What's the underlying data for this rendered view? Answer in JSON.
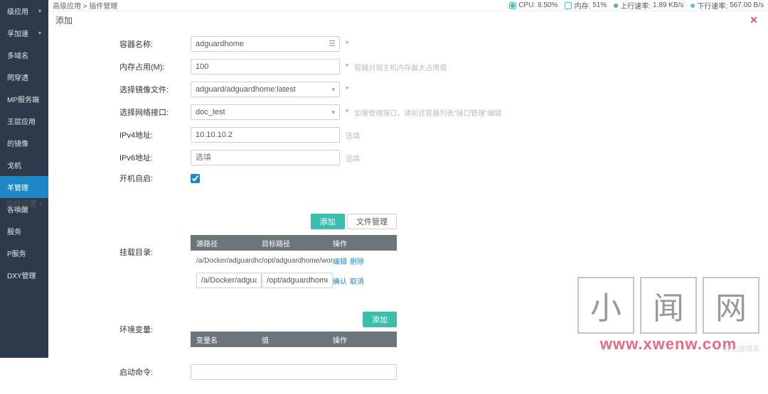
{
  "breadcrumb": {
    "a": "高级应用",
    "sep": ">",
    "b": "插件管理"
  },
  "status": {
    "cpu_label": "CPU:",
    "cpu_val": "8.50%",
    "mem_label": "内存:",
    "mem_val": "51%",
    "up_label": "上行速率:",
    "up_val": "1.89 KB/s",
    "dn_label": "下行速率:",
    "dn_val": "567.00 B/s"
  },
  "panel": {
    "title": "添加",
    "close": "✕"
  },
  "sidebar": {
    "items": [
      {
        "label": "级应用",
        "expand": true
      },
      {
        "label": "孚加速",
        "expand": true
      },
      {
        "label": "多域名"
      },
      {
        "label": "罔穿透"
      },
      {
        "label": "MP服务端"
      },
      {
        "label": "王层应用"
      },
      {
        "label": "的镜像"
      },
      {
        "label": "戈机"
      },
      {
        "label": "羊管理",
        "active": true
      },
      {
        "label": "各唤醒"
      },
      {
        "label": "服务"
      },
      {
        "label": "P服务"
      },
      {
        "label": "DXY管理"
      }
    ]
  },
  "form": {
    "container_name": {
      "label": "容器名称:",
      "value": "adguardhome"
    },
    "mem": {
      "label": "内存占用(M):",
      "value": "100",
      "hint": "容器对宿主机内存最大占用值"
    },
    "image": {
      "label": "选择镜像文件:",
      "value": "adguard/adguardhome:latest"
    },
    "net": {
      "label": "选择网络接口:",
      "value": "doc_test",
      "hint": "如需管理接口，请前往容器列表\"接口管理\"编辑"
    },
    "ipv4": {
      "label": "IPv4地址:",
      "value": "10.10.10.2",
      "ph": "选填"
    },
    "ipv6": {
      "label": "IPv6地址:",
      "value": "",
      "ph": "选填"
    },
    "autostart": {
      "label": "开机自启:"
    },
    "req": "*"
  },
  "advanced_label": "高级设置",
  "mount": {
    "label": "挂载目录:",
    "add_btn": "添加",
    "fm_btn": "文件管理",
    "head": {
      "c1": "源路径",
      "c2": "目标路径",
      "c3": "操作"
    },
    "rows": [
      {
        "src": "/a/Docker/adguardhome",
        "dst": "/opt/adguardhome/worl",
        "edit": "编辑",
        "del": "删除"
      }
    ],
    "edit_row": {
      "src": "/a/Docker/adguardhome",
      "dst": "/opt/adguardhome/conf",
      "ok": "确认",
      "cancel": "取消"
    }
  },
  "env": {
    "label": "环境变量:",
    "add_btn": "添加",
    "head": {
      "c1": "变量名",
      "c2": "值",
      "c3": "操作"
    }
  },
  "cmd": {
    "label": "启动命令:"
  },
  "watermark": {
    "chars": [
      "小",
      "闻",
      "网"
    ],
    "url": "www.xwenw.com",
    "stamp": "什么值得买"
  }
}
